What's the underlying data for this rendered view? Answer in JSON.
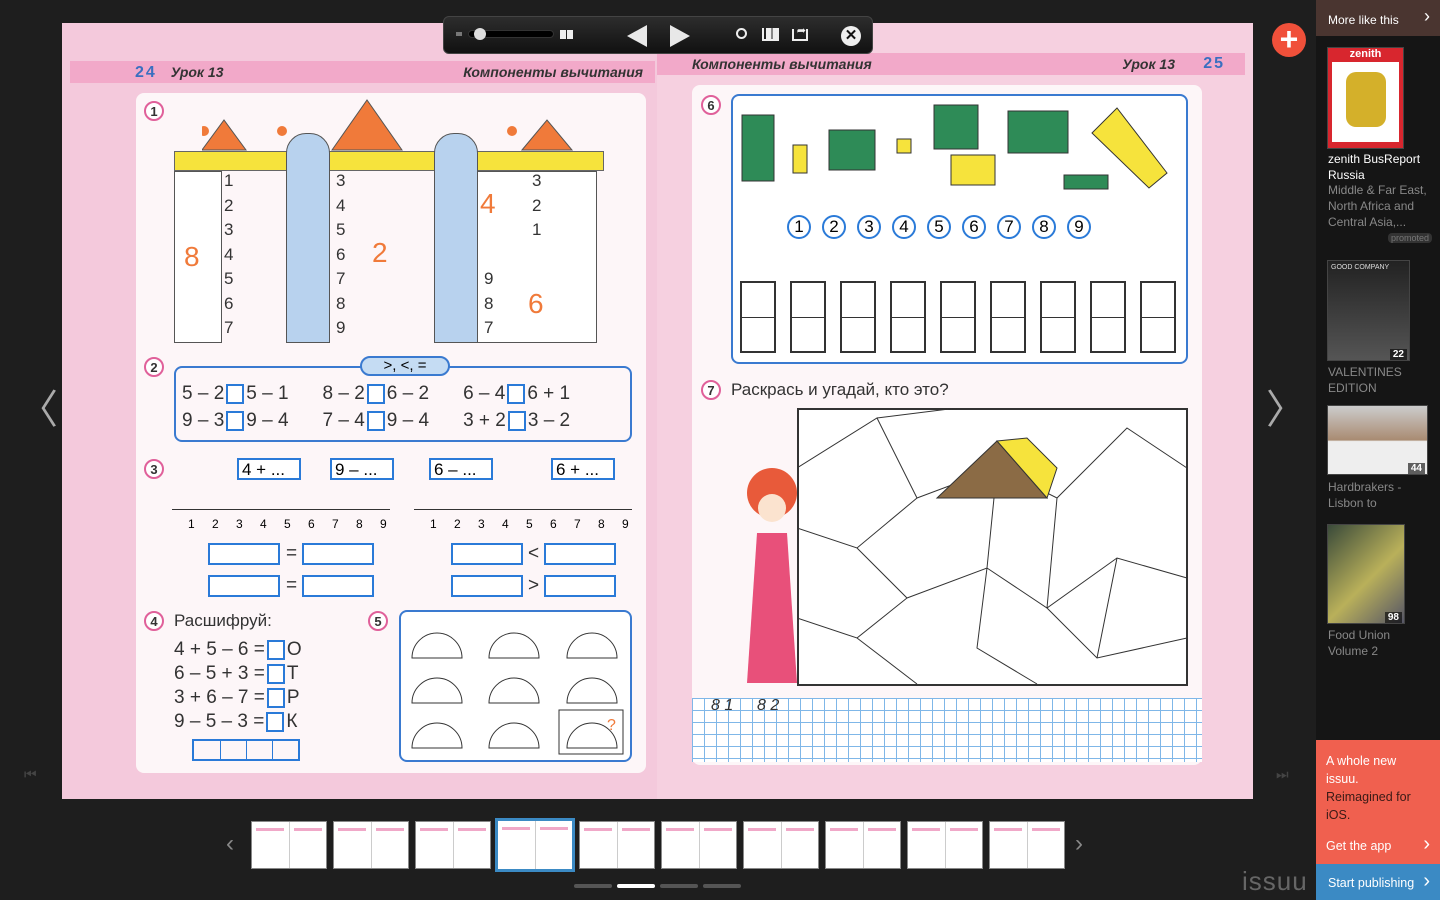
{
  "left_page": {
    "number": "24",
    "lesson": "Урок 13",
    "topic": "Компоненты вычитания",
    "ex1": {
      "num": "1",
      "t1": "8",
      "t2": "2",
      "t3": "4",
      "t4": "6",
      "col1": [
        "1",
        "2",
        "3",
        "4",
        "5",
        "6",
        "7"
      ],
      "col2": [
        "3",
        "4",
        "5",
        "6",
        "7",
        "8",
        "9"
      ],
      "col3a": [
        "3",
        "2",
        "1"
      ],
      "col3b": [
        "9",
        "8",
        "7"
      ]
    },
    "ex2": {
      "num": "2",
      "sign": ">, <, =",
      "rows": [
        [
          "5 – 2",
          "5 – 1",
          "8 – 2",
          "6 – 2",
          "6 – 4",
          "6 + 1"
        ],
        [
          "9 – 3",
          "9 – 4",
          "7 – 4",
          "9 – 4",
          "3 + 2",
          "3 – 2"
        ]
      ]
    },
    "ex3": {
      "num": "3",
      "labels": [
        "4 + ...",
        "9 – ...",
        "6 – ...",
        "6 + ..."
      ],
      "ticks": [
        "1",
        "2",
        "3",
        "4",
        "5",
        "6",
        "7",
        "8",
        "9"
      ],
      "signs": [
        "=",
        "=",
        "<",
        ">"
      ]
    },
    "ex4": {
      "num": "4",
      "title": "Расшифруй:",
      "rows": [
        {
          "eq": "4 + 5 – 6 =",
          "letter": "О"
        },
        {
          "eq": "6 – 5 + 3 =",
          "letter": "Т"
        },
        {
          "eq": "3 + 6 – 7 =",
          "letter": "Р"
        },
        {
          "eq": "9 – 5 – 3 =",
          "letter": "К"
        }
      ]
    },
    "ex5": {
      "num": "5",
      "q": "?"
    }
  },
  "right_page": {
    "number": "25",
    "lesson": "Урок 13",
    "topic": "Компоненты вычитания",
    "ex6": {
      "num": "6",
      "circles": [
        "1",
        "2",
        "3",
        "4",
        "5",
        "6",
        "7",
        "8",
        "9"
      ]
    },
    "ex7": {
      "num": "7",
      "title": "Раскрась и угадай, кто это?",
      "writing": [
        "8 1",
        "8 2"
      ]
    }
  },
  "toolbar": {
    "zoom_level": 0.1
  },
  "sidebar": {
    "header": "More like this",
    "items": [
      {
        "title": "zenith BusReport Russia",
        "desc": "Middle & Far East, North Africa and Central Asia,...",
        "badge": "promoted",
        "cover_text": "zenith"
      },
      {
        "title": "VALENTINES EDITION",
        "count": "22",
        "cover_text": "GOOD COMPANY"
      },
      {
        "title": "Hardbrakers - Lisbon to",
        "count": "44"
      },
      {
        "title": "Food Union Volume 2",
        "count": "98"
      }
    ],
    "promo": {
      "line1": "A whole new issuu.",
      "line2": "Reimagined for iOS.",
      "cta": "Get the app"
    },
    "publish": "Start publishing"
  },
  "brand": "issuu",
  "thumbnails": {
    "count": 10,
    "active": 4
  },
  "page_dots": {
    "count": 4,
    "active": 2
  },
  "colors": {
    "accent": "#f0604f",
    "publish": "#3b8ac4",
    "sidebar_header": "#4a3530",
    "plus": "#f0503a"
  }
}
